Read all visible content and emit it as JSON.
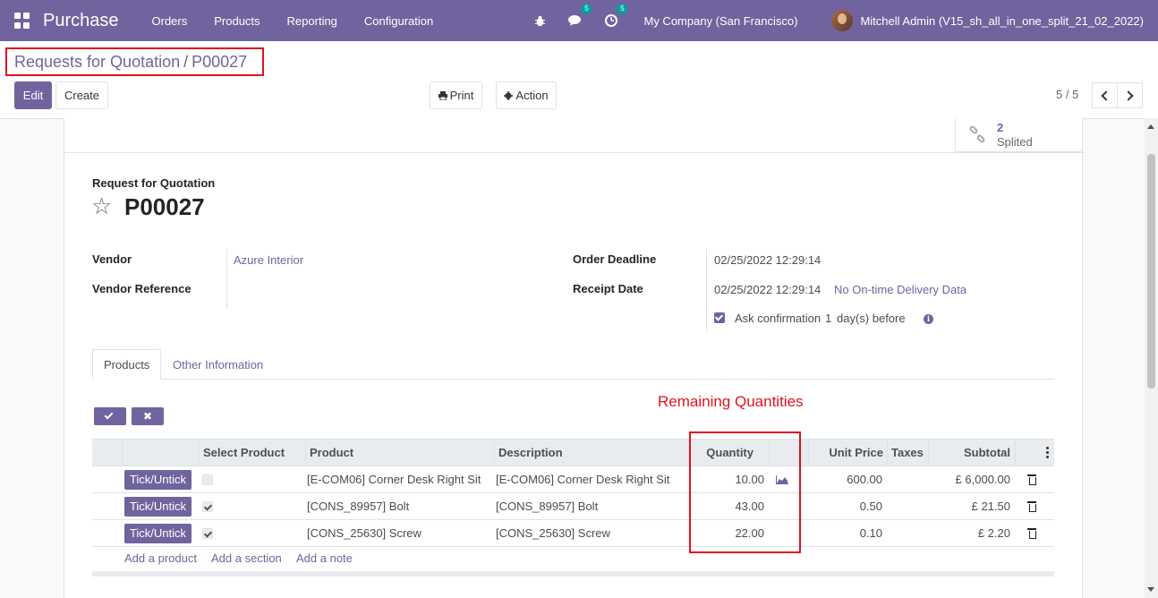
{
  "navbar": {
    "app_name": "Purchase",
    "menu": [
      "Orders",
      "Products",
      "Reporting",
      "Configuration"
    ],
    "chat_badge": "5",
    "activity_badge": "5",
    "company": "My Company (San Francisco)",
    "user": "Mitchell Admin (V15_sh_all_in_one_split_21_02_2022)"
  },
  "breadcrumb": {
    "parent": "Requests for Quotation",
    "separator": "/",
    "current": "P00027"
  },
  "control_panel": {
    "edit_label": "Edit",
    "create_label": "Create",
    "print_label": "Print",
    "action_label": "Action",
    "pager": "5 / 5"
  },
  "smart_button": {
    "count": "2",
    "label": "Splited"
  },
  "form": {
    "doc_type": "Request for Quotation",
    "name": "P00027",
    "vendor_label": "Vendor",
    "vendor_value": "Azure Interior",
    "vendor_ref_label": "Vendor Reference",
    "order_deadline_label": "Order Deadline",
    "order_deadline_value": "02/25/2022 12:29:14",
    "receipt_date_label": "Receipt Date",
    "receipt_date_value": "02/25/2022 12:29:14",
    "delivery_data_link": "No On-time Delivery Data",
    "ask_confirmation_label": "Ask confirmation",
    "ask_confirmation_days": "1",
    "ask_confirmation_suffix": "day(s) before"
  },
  "tabs": [
    "Products",
    "Other Information"
  ],
  "annotation": "Remaining Quantities",
  "table": {
    "headers": {
      "select_product": "Select Product",
      "product": "Product",
      "description": "Description",
      "quantity": "Quantity",
      "unit_price": "Unit Price",
      "taxes": "Taxes",
      "subtotal": "Subtotal"
    },
    "tick_label": "Tick/Untick",
    "rows": [
      {
        "selected": false,
        "product": "[E-COM06] Corner Desk Right Sit",
        "description": "[E-COM06] Corner Desk Right Sit",
        "quantity": "10.00",
        "unit_price": "600.00",
        "taxes": "",
        "subtotal": "£ 6,000.00"
      },
      {
        "selected": true,
        "product": "[CONS_89957] Bolt",
        "description": "[CONS_89957] Bolt",
        "quantity": "43.00",
        "unit_price": "0.50",
        "taxes": "",
        "subtotal": "£ 21.50"
      },
      {
        "selected": true,
        "product": "[CONS_25630] Screw",
        "description": "[CONS_25630] Screw",
        "quantity": "22.00",
        "unit_price": "0.10",
        "taxes": "",
        "subtotal": "£ 2.20"
      }
    ],
    "add_product": "Add a product",
    "add_section": "Add a section",
    "add_note": "Add a note"
  },
  "colors": {
    "brand": "#71639e",
    "annotation_red": "#e0131d"
  },
  "icons": [
    "apps-icon",
    "bug-icon",
    "chat-icon",
    "clock-icon",
    "star-icon",
    "print-icon",
    "gear-icon",
    "split-icon",
    "info-icon",
    "area-chart-icon",
    "trash-icon"
  ]
}
